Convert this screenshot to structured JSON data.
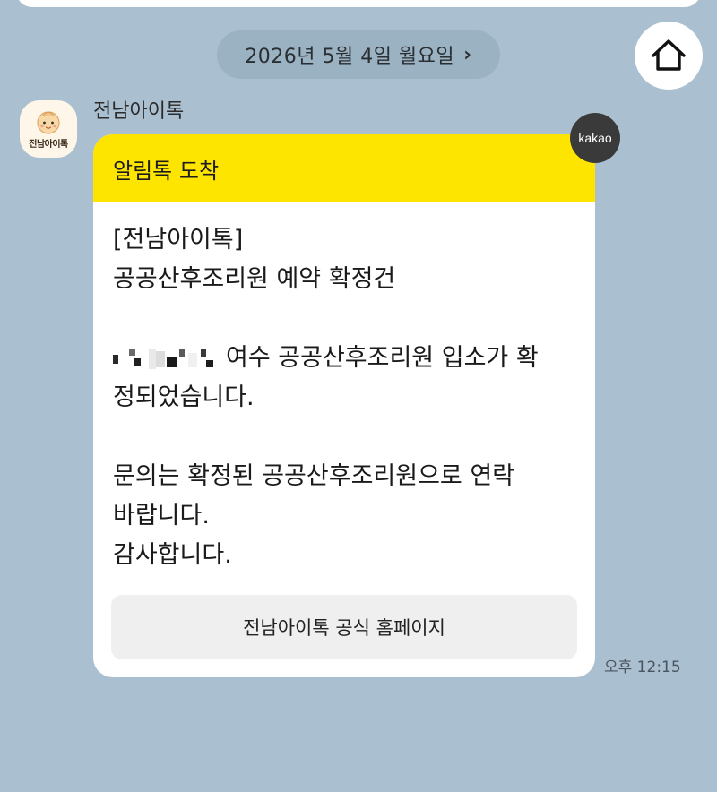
{
  "chat": {
    "date_label": "2026년 5월 4일 월요일",
    "date_chevron": "›",
    "sender_name": "전남아이톡",
    "profile_logo_text": "전남아이톡",
    "timestamp": "오후 12:15"
  },
  "message": {
    "header": "알림톡 도착",
    "body_lines": [
      "[전남아이톡]",
      "공공산후조리원 예약 확정건",
      "",
      "여수 공공산후조리원 입소가 확",
      "정되었습니다.",
      "",
      "문의는 확정된 공공산후조리원으로 연락",
      "바랍니다.",
      "감사합니다."
    ],
    "link_button_label": "전남아이톡 공식 홈페이지",
    "badge": "kakao"
  },
  "icons": {
    "home": "home-icon",
    "profile": "baby-logo-icon",
    "redacted": "redacted-name-blur"
  },
  "colors": {
    "chat_background": "#aabfd0",
    "bubble_header": "#fee500",
    "bubble_background": "#ffffff",
    "badge_background": "#3a3a3a",
    "link_button_background": "#efefef"
  }
}
